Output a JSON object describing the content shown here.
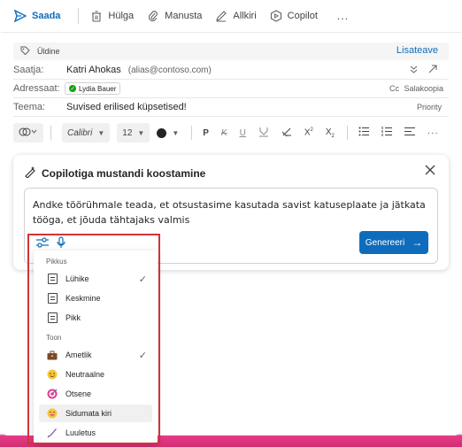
{
  "toolbar": {
    "send": "Saada",
    "discard": "Hülga",
    "save": "Manusta",
    "sign": "Allkiri",
    "copilot": "Copilot",
    "more": "..."
  },
  "header": {
    "sensitivity": "Üldine",
    "more_info": "Lisateave",
    "to_label": "Saatja:",
    "to_name": "Katri Ahokas",
    "to_alias": "(alias@contoso.com)",
    "recipient_label": "Adressaat:",
    "recipient_chip": "Lydia Bauer",
    "cc": "Cc",
    "bcc": "Salakoopia",
    "subject_label": "Teema:",
    "subject_value": "Suvised erilised küpsetised!",
    "priority": "Priority"
  },
  "format": {
    "font": "Calibri",
    "size": "12"
  },
  "copilot": {
    "title": "Copilotiga mustandi koostamine",
    "prompt": "Andke töörühmale teada, et otsustasime kasutada savist katuseplaate ja jätkata tööga, et jõuda tähtajaks valmis",
    "generate": "Genereeri"
  },
  "menu": {
    "length_header": "Pikkus",
    "tone_header": "Toon",
    "length": [
      {
        "label": "Lühike",
        "checked": true
      },
      {
        "label": "Keskmine",
        "checked": false
      },
      {
        "label": "Pikk",
        "checked": false
      }
    ],
    "tone": [
      {
        "label": "Ametlik",
        "icon": "briefcase-icon",
        "checked": true
      },
      {
        "label": "Neutraalne",
        "icon": "neutral-face-icon",
        "checked": false
      },
      {
        "label": "Otsene",
        "icon": "target-icon",
        "checked": false
      },
      {
        "label": "Sidumata kiri",
        "icon": "grin-face-icon",
        "checked": false
      },
      {
        "label": "Luuletus",
        "icon": "quill-icon",
        "checked": false
      }
    ]
  },
  "colors": {
    "accent": "#0f6cbd",
    "highlight_outline": "#d13438"
  }
}
